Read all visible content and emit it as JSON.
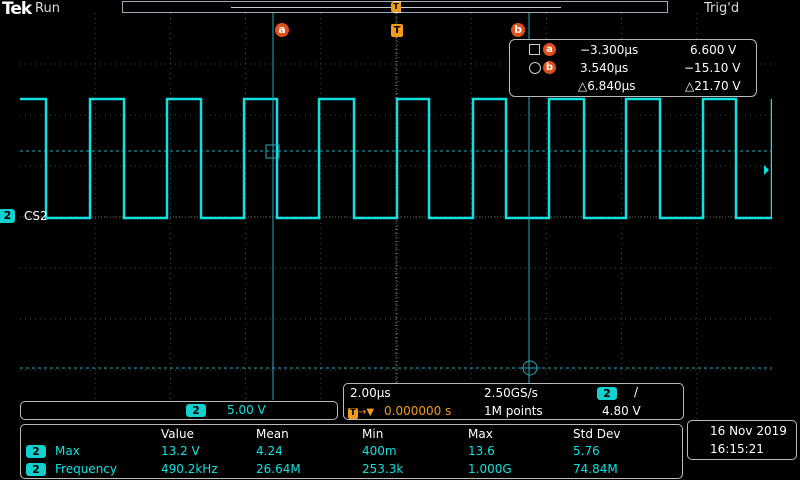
{
  "header": {
    "brand": "Tek",
    "run_state": "Run",
    "trigger_state": "Trig'd"
  },
  "markers": {
    "cursor_a": "a",
    "cursor_b": "b",
    "trigger": "T"
  },
  "cursor_readout": {
    "a_time": "−3.300μs",
    "a_volt": "6.600 V",
    "b_time": "3.540μs",
    "b_volt": "−15.10 V",
    "delta_time": "△6.840μs",
    "delta_volt": "△21.70 V"
  },
  "channel": {
    "number": "2",
    "label": "CS2",
    "color": "#10e0e0"
  },
  "vertical_scale": {
    "channel": "2",
    "value": "5.00 V"
  },
  "timebase": {
    "time_per_div": "2.00μs",
    "sample_rate": "2.50GS/s",
    "trig_channel": "2",
    "trig_slope": "/",
    "trig_position": "0.000000 s",
    "record_length": "1M points",
    "trig_level": "4.80 V"
  },
  "measurements": {
    "headers": [
      "Value",
      "Mean",
      "Min",
      "Max",
      "Std Dev"
    ],
    "rows": [
      {
        "channel": "2",
        "name": "Max",
        "cells": [
          "13.2 V",
          "4.24",
          "400m",
          "13.6",
          "5.76"
        ]
      },
      {
        "channel": "2",
        "name": "Frequency",
        "cells": [
          "490.2kHz",
          "26.64M",
          "253.3k",
          "1.000G",
          "74.84M"
        ]
      }
    ]
  },
  "datetime": {
    "date": "16 Nov 2019",
    "time": "16:15:21"
  },
  "colors": {
    "trace": "#10e0e0",
    "cursor_marker": "#e0501c",
    "trigger_marker": "#f29a1a"
  }
}
